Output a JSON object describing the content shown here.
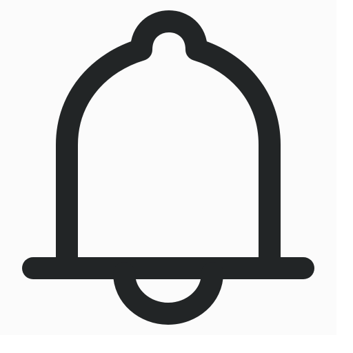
{
  "icon": {
    "name": "bell-icon",
    "stroke_color": "#222526",
    "tile_color": "#fbfbfb",
    "background_color": "#ffffff"
  }
}
